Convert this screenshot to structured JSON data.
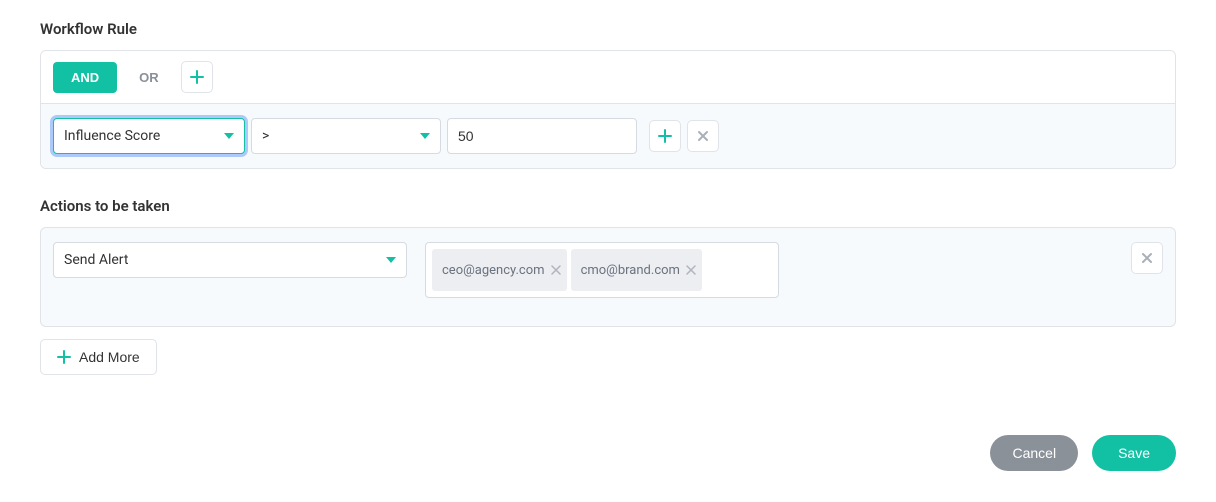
{
  "workflow_rule": {
    "title": "Workflow Rule",
    "and_label": "AND",
    "or_label": "OR",
    "condition": {
      "field": "Influence Score",
      "operator": ">",
      "value": "50"
    }
  },
  "actions": {
    "title": "Actions to be taken",
    "type": "Send Alert",
    "recipients": [
      "ceo@agency.com",
      "cmo@brand.com"
    ],
    "add_more_label": "Add More"
  },
  "footer": {
    "cancel_label": "Cancel",
    "save_label": "Save"
  }
}
